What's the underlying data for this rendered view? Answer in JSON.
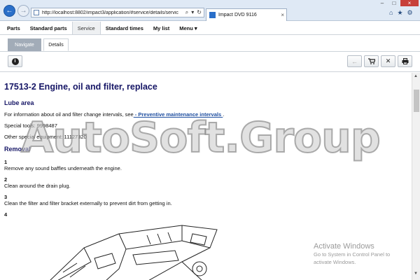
{
  "browser": {
    "url": "http://localhost:8802/impact3/application/#service/details/servic",
    "tab_title": "Impact DVD 9116",
    "tab_close": "×",
    "back_icon": "arrow-left-icon",
    "forward_icon": "arrow-right-icon",
    "window_min": "–",
    "window_max": "□",
    "window_close": "×"
  },
  "menu": {
    "items": [
      "Parts",
      "Standard parts",
      "Service",
      "Standard times",
      "My list",
      "Menu ▾"
    ],
    "active": "Service"
  },
  "subtabs": {
    "navigate": "Navigate",
    "details": "Details"
  },
  "doc": {
    "title": "17513-2 Engine, oil and filter, replace",
    "lube_heading": "Lube area",
    "info_text": "For information about oil and filter change intervals, see",
    "info_link": " - Preventive maintenance intervals ",
    "info_end": ".",
    "special_tools": "Special tools: 9998487",
    "other_equipment": "Other special equipment: 11127320",
    "removal_heading": "Removal",
    "steps": [
      {
        "num": "1",
        "text": "Remove any sound baffles underneath the engine."
      },
      {
        "num": "2",
        "text": "Clean around the drain plug."
      },
      {
        "num": "3",
        "text": "Clean the filter and filter bracket externally to prevent dirt from getting in."
      },
      {
        "num": "4",
        "text": ""
      }
    ]
  },
  "overlay": {
    "watermark": "AutoSoft.Group",
    "activate_title": "Activate Windows",
    "activate_line1": "Go to System in Control Panel to",
    "activate_line2": "activate Windows."
  },
  "colors": {
    "heading": "#151565",
    "link": "#1f4fa0",
    "navigate_tab": "#a2acb8"
  }
}
